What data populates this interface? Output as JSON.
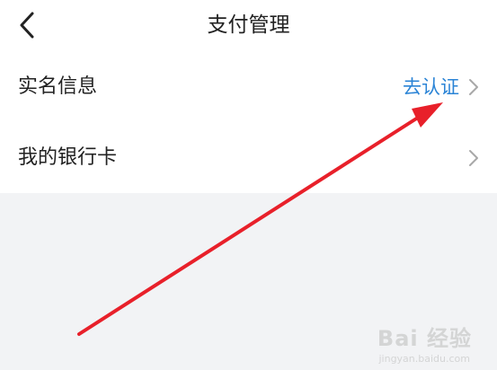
{
  "header": {
    "title": "支付管理",
    "back_icon": "chevron-left-icon"
  },
  "items": [
    {
      "label": "实名信息",
      "action": "去认证",
      "action_color": "#2b84d6",
      "chevron_icon": "chevron-right-icon"
    },
    {
      "label": "我的银行卡",
      "action": "",
      "chevron_icon": "chevron-right-icon"
    }
  ],
  "annotation": {
    "arrow_color": "#e8202a",
    "arrow_icon": "red-arrow-annotation"
  },
  "watermark": {
    "text": "Bai 经验",
    "sub": "jingyan.baidu.com"
  }
}
